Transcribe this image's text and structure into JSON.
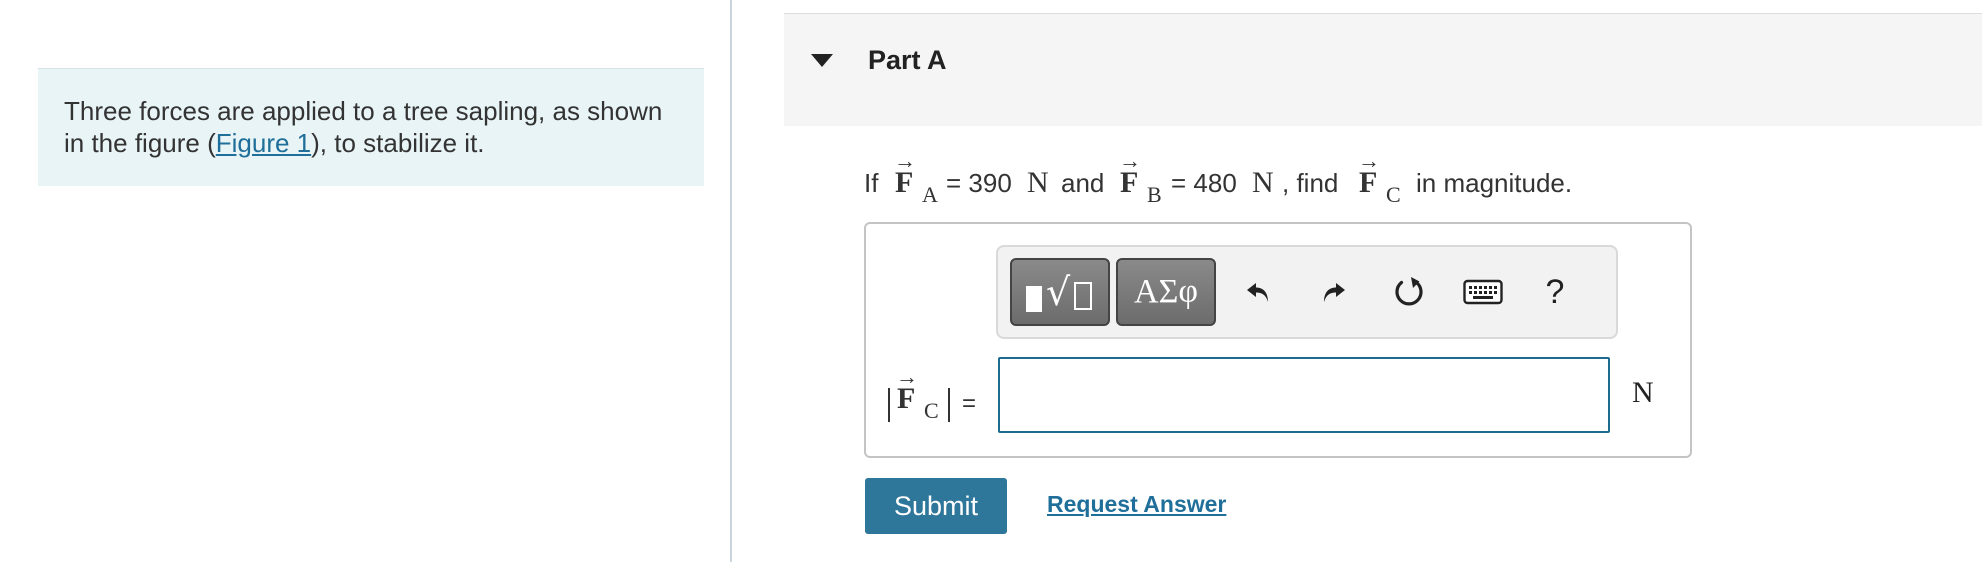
{
  "intro": {
    "text_before": "Three forces are applied to a tree sapling, as shown in the figure (",
    "figure_link": "Figure 1",
    "text_after": "), to stabilize it."
  },
  "part": {
    "title": "Part A",
    "caret_icon": "caret-down-icon"
  },
  "question": {
    "if": "If",
    "arrow": "→",
    "vector_symbol": "F",
    "fa_sub": "A",
    "fa_value": "= 390",
    "unit": "N",
    "and": "and",
    "fb_sub": "B",
    "fb_value": "= 480",
    "find": ", find",
    "fc_sub": "C",
    "tail": "in magnitude."
  },
  "toolbar": {
    "templates_icon": "templates-icon",
    "symbols_label": "ΑΣφ",
    "undo_icon": "undo-icon",
    "redo_icon": "redo-icon",
    "reset_icon": "reset-icon",
    "keyboard_icon": "keyboard-icon",
    "help_label": "?"
  },
  "answer": {
    "label_sub": "C",
    "equals": "=",
    "value": "",
    "unit": "N"
  },
  "actions": {
    "submit_label": "Submit",
    "request_label": "Request Answer"
  },
  "colors": {
    "accent": "#2f779a",
    "link": "#1f6f9a",
    "intro_bg": "#e8f4f6",
    "input_border": "#1d6b8f"
  }
}
